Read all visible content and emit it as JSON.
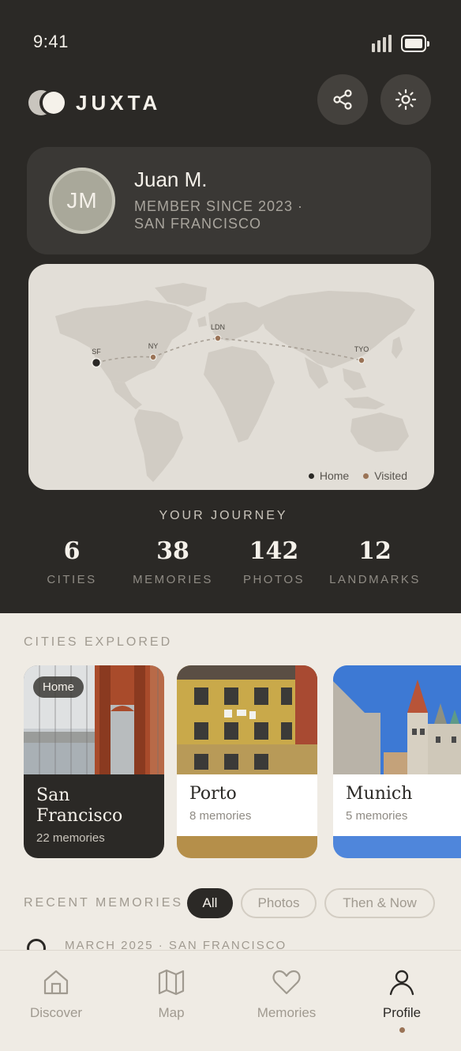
{
  "status_bar": {
    "time": "9:41"
  },
  "app": {
    "name": "JUXTA"
  },
  "header": {
    "share_icon": "share-icon",
    "settings_icon": "sun-icon"
  },
  "profile": {
    "initials": "JM",
    "name": "Juan M.",
    "meta_line1": "MEMBER SINCE 2023 ·",
    "meta_line2": "SAN FRANCISCO"
  },
  "map": {
    "markers": [
      {
        "code": "SF",
        "type": "home"
      },
      {
        "code": "NY",
        "type": "visited"
      },
      {
        "code": "LDN",
        "type": "visited"
      },
      {
        "code": "TYO",
        "type": "visited"
      }
    ],
    "legend": {
      "home": "Home",
      "visited": "Visited"
    },
    "colors": {
      "home": "#2b2926",
      "visited": "#9a7356",
      "land": "#d1ccc4",
      "route": "#a8a096"
    }
  },
  "journey": {
    "title": "YOUR JOURNEY",
    "stats": [
      {
        "value": "6",
        "label": "CITIES"
      },
      {
        "value": "38",
        "label": "MEMORIES"
      },
      {
        "value": "142",
        "label": "PHOTOS"
      },
      {
        "value": "12",
        "label": "LANDMARKS"
      }
    ]
  },
  "cities": {
    "title": "CITIES EXPLORED",
    "items": [
      {
        "name_line1": "San",
        "name_line2": "Francisco",
        "count": "22 memories",
        "badge": "Home",
        "accent": "#2b2926"
      },
      {
        "name_line1": "Porto",
        "count": "8 memories",
        "accent": "#b58f4a"
      },
      {
        "name_line1": "Munich",
        "count": "5 memories",
        "accent": "#4f86db"
      }
    ]
  },
  "recent": {
    "title": "RECENT MEMORIES",
    "filters": [
      "All",
      "Photos",
      "Then & Now"
    ],
    "active_filter": "All",
    "first_item_meta": "MARCH 2025 · SAN FRANCISCO"
  },
  "tabbar": {
    "tabs": [
      {
        "label": "Discover",
        "icon": "home-icon"
      },
      {
        "label": "Map",
        "icon": "map-icon"
      },
      {
        "label": "Memories",
        "icon": "heart-icon"
      },
      {
        "label": "Profile",
        "icon": "person-icon"
      }
    ],
    "active": "Profile"
  }
}
